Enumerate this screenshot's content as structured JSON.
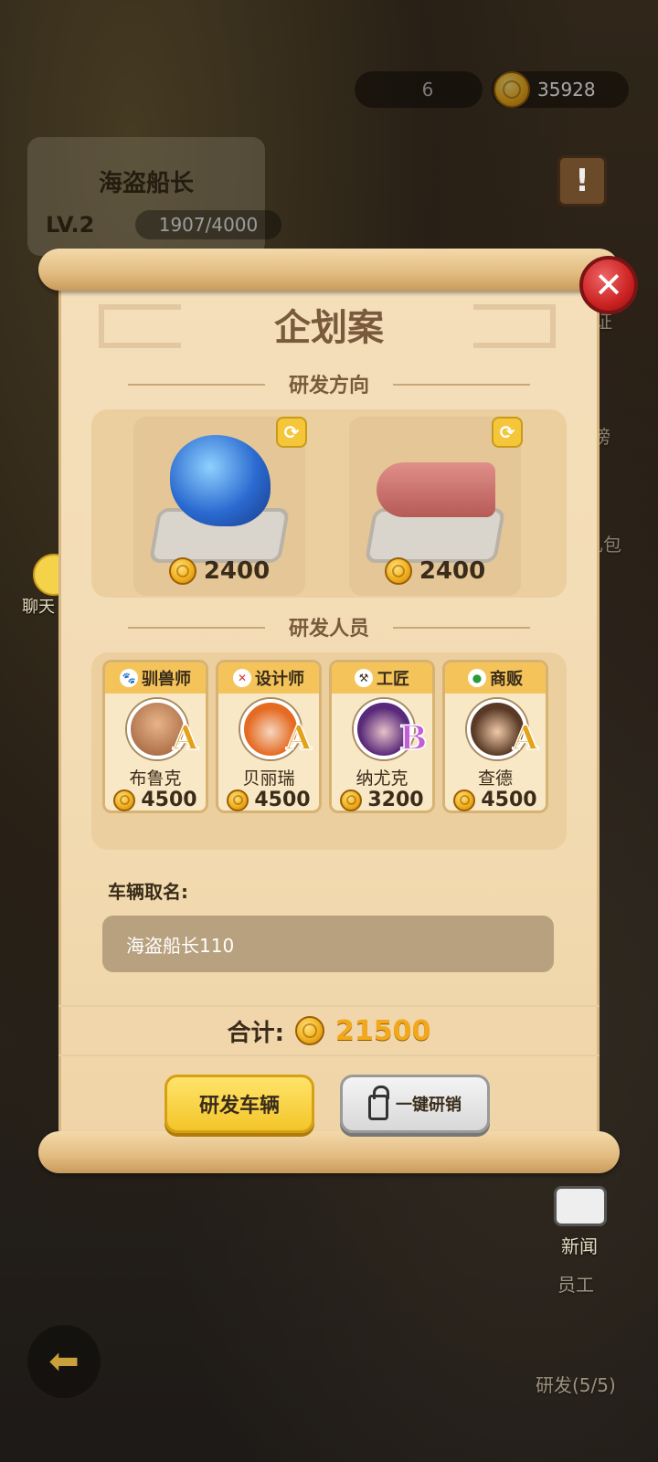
{
  "hud": {
    "ticket_count": "6",
    "coin_count": "35928"
  },
  "player": {
    "name": "海盗船长",
    "level": "LV.2",
    "xp": "1907/4000"
  },
  "side": {
    "chat": "聊天",
    "news": "新闻",
    "staff": "员工",
    "research": "研发(5/5)",
    "gift": "礼包",
    "rank": "榜",
    "cert": "证"
  },
  "dialog": {
    "title": "企划案",
    "direction_heading": "研发方向",
    "directions": [
      {
        "name": "dragon",
        "cost": "2400"
      },
      {
        "name": "drill-vehicle",
        "cost": "2400"
      }
    ],
    "staff_heading": "研发人员",
    "staff": [
      {
        "role": "驯兽师",
        "name": "布鲁克",
        "grade": "A",
        "cost": "4500",
        "grade_color": "#e3a21a"
      },
      {
        "role": "设计师",
        "name": "贝丽瑞",
        "grade": "A",
        "cost": "4500",
        "grade_color": "#e3a21a"
      },
      {
        "role": "工匠",
        "name": "纳尤克",
        "grade": "B",
        "cost": "3200",
        "grade_color": "#c25ed6"
      },
      {
        "role": "商贩",
        "name": "查德",
        "grade": "A",
        "cost": "4500",
        "grade_color": "#e3a21a"
      }
    ],
    "name_label": "车辆取名:",
    "name_value": "海盗船长110",
    "total_label": "合计:",
    "total_value": "21500",
    "develop_button": "研发车辆",
    "sell_button": "一键研销"
  }
}
